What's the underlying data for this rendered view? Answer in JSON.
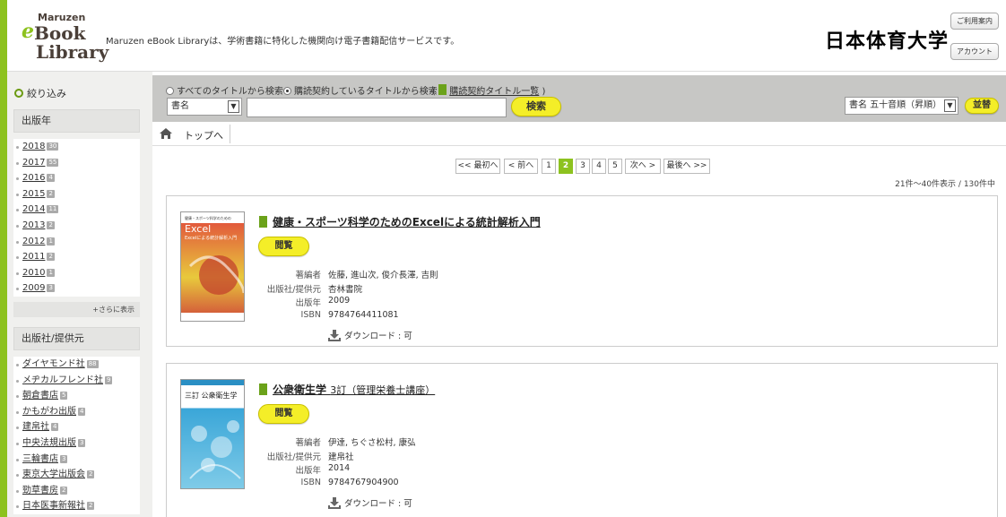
{
  "header": {
    "logo": {
      "line1": "Maruzen",
      "line2": "e",
      "line3": "Book",
      "line4": "Library"
    },
    "tagline": "Maruzen eBook Libraryは、学術書籍に特化した機関向け電子書籍配信サービスです。",
    "university": "日本体育大学",
    "guide_button": "ご利用案内",
    "account_button": "アカウント"
  },
  "sidebar": {
    "filter_label": "絞り込み",
    "year_section": {
      "title": "出版年",
      "items": [
        {
          "label": "2018",
          "count": "30"
        },
        {
          "label": "2017",
          "count": "55"
        },
        {
          "label": "2016",
          "count": "4"
        },
        {
          "label": "2015",
          "count": "2"
        },
        {
          "label": "2014",
          "count": "11"
        },
        {
          "label": "2013",
          "count": "2"
        },
        {
          "label": "2012",
          "count": "1"
        },
        {
          "label": "2011",
          "count": "2"
        },
        {
          "label": "2010",
          "count": "1"
        },
        {
          "label": "2009",
          "count": "3"
        }
      ],
      "more": "+さらに表示"
    },
    "publisher_section": {
      "title": "出版社/提供元",
      "items": [
        {
          "label": "ダイヤモンド社",
          "count": "88"
        },
        {
          "label": "メヂカルフレンド社",
          "count": "9"
        },
        {
          "label": "朝倉書店",
          "count": "5"
        },
        {
          "label": "かもがわ出版",
          "count": "4"
        },
        {
          "label": "建帛社",
          "count": "4"
        },
        {
          "label": "中央法規出版",
          "count": "3"
        },
        {
          "label": "三輪書店",
          "count": "3"
        },
        {
          "label": "東京大学出版会",
          "count": "2"
        },
        {
          "label": "勁草書房",
          "count": "2"
        },
        {
          "label": "日本医事新報社",
          "count": "2"
        }
      ]
    }
  },
  "search": {
    "radio_all": "すべてのタイトルから検索",
    "radio_subscribed": "購読契約しているタイトルから検索",
    "paren_open": "(",
    "list_link": "購読契約タイトル一覧",
    "paren_close": ")",
    "field_select": "書名",
    "query": "",
    "search_button": "検索",
    "sort_select": "書名 五十音順（昇順）",
    "sort_button": "並替"
  },
  "breadcrumb": {
    "home": "トップへ"
  },
  "pager": {
    "first": "<< 最初へ",
    "prev": "< 前へ",
    "pages": [
      "1",
      "2",
      "3",
      "4",
      "5"
    ],
    "current": "2",
    "next": "次へ >",
    "last": "最後へ >>",
    "summary": "21件～40件表示 / 130件中"
  },
  "results": [
    {
      "title": "健康・スポーツ科学のためのExcelによる統計解析入門",
      "edition": "",
      "view_button": "閲覧",
      "fields": [
        {
          "k": "著編者",
          "v": "佐藤, 進山次, 俊介長澤, 吉則"
        },
        {
          "k": "出版社/提供元",
          "v": "杏林書院"
        },
        {
          "k": "出版年",
          "v": "2009"
        },
        {
          "k": "ISBN",
          "v": "9784764411081"
        }
      ],
      "download": "ダウンロード : 可",
      "cover_text": "Excelによる統計解析入門"
    },
    {
      "title": "公衆衛生学",
      "edition": "3訂（管理栄養士講座）",
      "view_button": "閲覧",
      "fields": [
        {
          "k": "著編者",
          "v": "伊達, ちぐさ松村, 康弘"
        },
        {
          "k": "出版社/提供元",
          "v": "建帛社"
        },
        {
          "k": "出版年",
          "v": "2014"
        },
        {
          "k": "ISBN",
          "v": "9784767904900"
        }
      ],
      "download": "ダウンロード : 可",
      "cover_text": "三訂 公衆衛生学"
    }
  ],
  "colors": {
    "accent": "#8dc21f",
    "button": "#f4ee28",
    "search_bg": "#c7c7c5",
    "sidebar_bg": "#f0f0ee"
  }
}
